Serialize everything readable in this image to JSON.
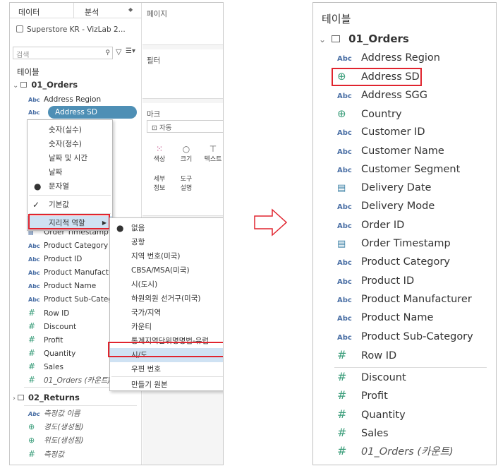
{
  "left": {
    "tab_data": "데이터",
    "tab_analysis": "분석",
    "datasource": "Superstore KR - VizLab 2...",
    "search_placeholder": "검색",
    "section_title": "테이블",
    "table1": "01_Orders",
    "fields_top": [
      "Address Region"
    ],
    "highlighted_field": "Address SD",
    "fields_mid": [
      {
        "label": "Order Timestamp",
        "icon": "cal"
      },
      {
        "label": "Product Category",
        "icon": "abc"
      },
      {
        "label": "Product ID",
        "icon": "abc"
      },
      {
        "label": "Product Manufactu",
        "icon": "abc"
      },
      {
        "label": "Product Name",
        "icon": "abc"
      },
      {
        "label": "Product Sub-Categ",
        "icon": "abc"
      },
      {
        "label": "Row ID",
        "icon": "hash"
      }
    ],
    "measures": [
      "Discount",
      "Profit",
      "Quantity",
      "Sales",
      "01_Orders (카운트)"
    ],
    "table2": "02_Returns",
    "bottom_fields": [
      {
        "label": "측정값 이름",
        "icon": "abc"
      },
      {
        "label": "경도(생성됨)",
        "icon": "glb"
      },
      {
        "label": "위도(생성됨)",
        "icon": "glb"
      },
      {
        "label": "측정값",
        "icon": "hash"
      }
    ],
    "pages_label": "페이지",
    "filters_label": "필터",
    "marks_label": "마크",
    "marks_type": "자동",
    "mark_buttons": [
      {
        "icon": "colors-icon",
        "label": "색상"
      },
      {
        "icon": "size-icon",
        "label": "크기"
      },
      {
        "icon": "text-icon",
        "label": "텍스트"
      },
      {
        "icon": "detail-icon",
        "label": "세부\n정보"
      },
      {
        "icon": "tooltip-icon",
        "label": "도구\n설명"
      }
    ],
    "context_menu": {
      "items": [
        "숫자(실수)",
        "숫자(정수)",
        "날짜 및 시간",
        "날짜",
        "문자열"
      ],
      "selected": "문자열",
      "default_label": "기본값",
      "geo_role": "지리적 역할"
    },
    "geo_menu": {
      "items": [
        "없음",
        "공항",
        "지역 번호(미국)",
        "CBSA/MSA(미국)",
        "시(도시)",
        "하원의원 선거구(미국)",
        "국가/지역",
        "카운티",
        "통계지역단위명명법-유럽",
        "시/도",
        "우편 번호"
      ],
      "selected": "없음",
      "highlighted": "시/도",
      "create_from": "만들기 원본"
    }
  },
  "right": {
    "section_title": "테이블",
    "table": "01_Orders",
    "fields": [
      {
        "label": "Address Region",
        "icon": "abc"
      },
      {
        "label": "Address SD",
        "icon": "glb"
      },
      {
        "label": "Address SGG",
        "icon": "abc"
      },
      {
        "label": "Country",
        "icon": "glb"
      },
      {
        "label": "Customer ID",
        "icon": "abc"
      },
      {
        "label": "Customer Name",
        "icon": "abc"
      },
      {
        "label": "Customer Segment",
        "icon": "abc"
      },
      {
        "label": "Delivery Date",
        "icon": "cal"
      },
      {
        "label": "Delivery Mode",
        "icon": "abc"
      },
      {
        "label": "Order ID",
        "icon": "abc"
      },
      {
        "label": "Order Timestamp",
        "icon": "cal"
      },
      {
        "label": "Product Category",
        "icon": "abc"
      },
      {
        "label": "Product ID",
        "icon": "abc"
      },
      {
        "label": "Product Manufacturer",
        "icon": "abc"
      },
      {
        "label": "Product Name",
        "icon": "abc"
      },
      {
        "label": "Product Sub-Category",
        "icon": "abc"
      },
      {
        "label": "Row ID",
        "icon": "hash"
      }
    ],
    "measures": [
      "Discount",
      "Profit",
      "Quantity",
      "Sales",
      "01_Orders (카운트)"
    ]
  },
  "icon_glyphs": {
    "abc": "Abc",
    "hash": "#",
    "glb": "⊕",
    "cal": "📅"
  },
  "colors": {
    "highlight": "#4e8fb5",
    "red_box": "#e0242e",
    "measure": "#3a9d7a"
  }
}
